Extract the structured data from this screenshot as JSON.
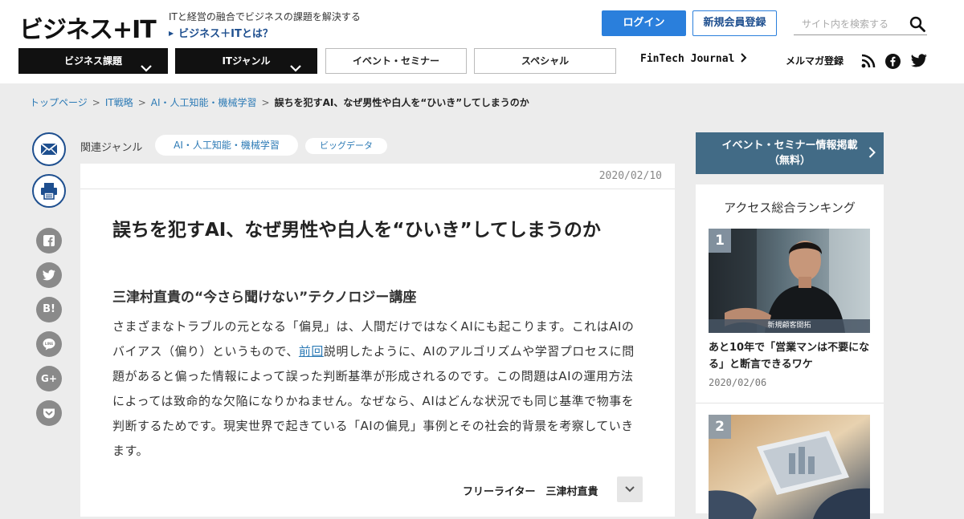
{
  "header": {
    "logo": "ビジネス+IT",
    "tagline": "ITと経営の融合でビジネスの課題を解決する",
    "about_link": "ビジネス＋ITとは？",
    "login": "ログイン",
    "register": "新規会員登録",
    "search_placeholder": "サイト内を検索する"
  },
  "nav": {
    "business": "ビジネス課題",
    "it": "ITジャンル",
    "events": "イベント・セミナー",
    "special": "スペシャル",
    "fintech": "FinTech Journal",
    "mailmag": "メルマガ登録"
  },
  "breadcrumb": {
    "home": "トップページ",
    "it_strategy": "IT戦略",
    "ai": "AI・人工知能・機械学習",
    "current": "誤ちを犯すAI、なぜ男性や白人を“ひいき”してしまうのか"
  },
  "genres": {
    "label": "関連ジャンル",
    "tags": [
      "AI・人工知能・機械学習",
      "ビッグデータ"
    ]
  },
  "share": {
    "hatena": "B!",
    "line": "LINE",
    "gplus": "G+"
  },
  "article": {
    "date": "2020/02/10",
    "title": "誤ちを犯すAI、なぜ男性や白人を“ひいき”してしまうのか",
    "subtitle": "三津村直貴の“今さら聞けない”テクノロジー講座",
    "lead_1": "さまざまなトラブルの元となる「偏見」は、人間だけではなくAIにも起こります。これはAIのバイアス（偏り）というもので、",
    "lead_link": "前回",
    "lead_2": "説明したように、AIのアルゴリズムや学習プロセスに問題があると偏った情報によって誤った判断基準が形成されるのです。この問題はAIの運用方法によっては致命的な欠陥になりかねません。なぜなら、AIはどんな状況でも同じ基準で物事を判断するためです。現実世界で起きている「AIの偏見」事例とその社会的背景を考察していきます。",
    "author": "フリーライター　三津村直貴"
  },
  "sidebar": {
    "event_line1": "イベント・セミナー情報掲載",
    "event_line2": "（無料）",
    "ranking_title": "アクセス総合ランキング",
    "items": [
      {
        "rank": "1",
        "caption": "新規顧客開拓",
        "title": "あと10年で「営業マンは不要になる」と断言できるワケ",
        "date": "2020/02/06"
      },
      {
        "rank": "2",
        "caption": "",
        "title": "",
        "date": ""
      }
    ]
  },
  "colors": {
    "accent": "#2a7fdc",
    "link": "#2c7ab5",
    "navy": "#1e4f8f",
    "event_button": "#426b86",
    "background": "#ececec"
  }
}
